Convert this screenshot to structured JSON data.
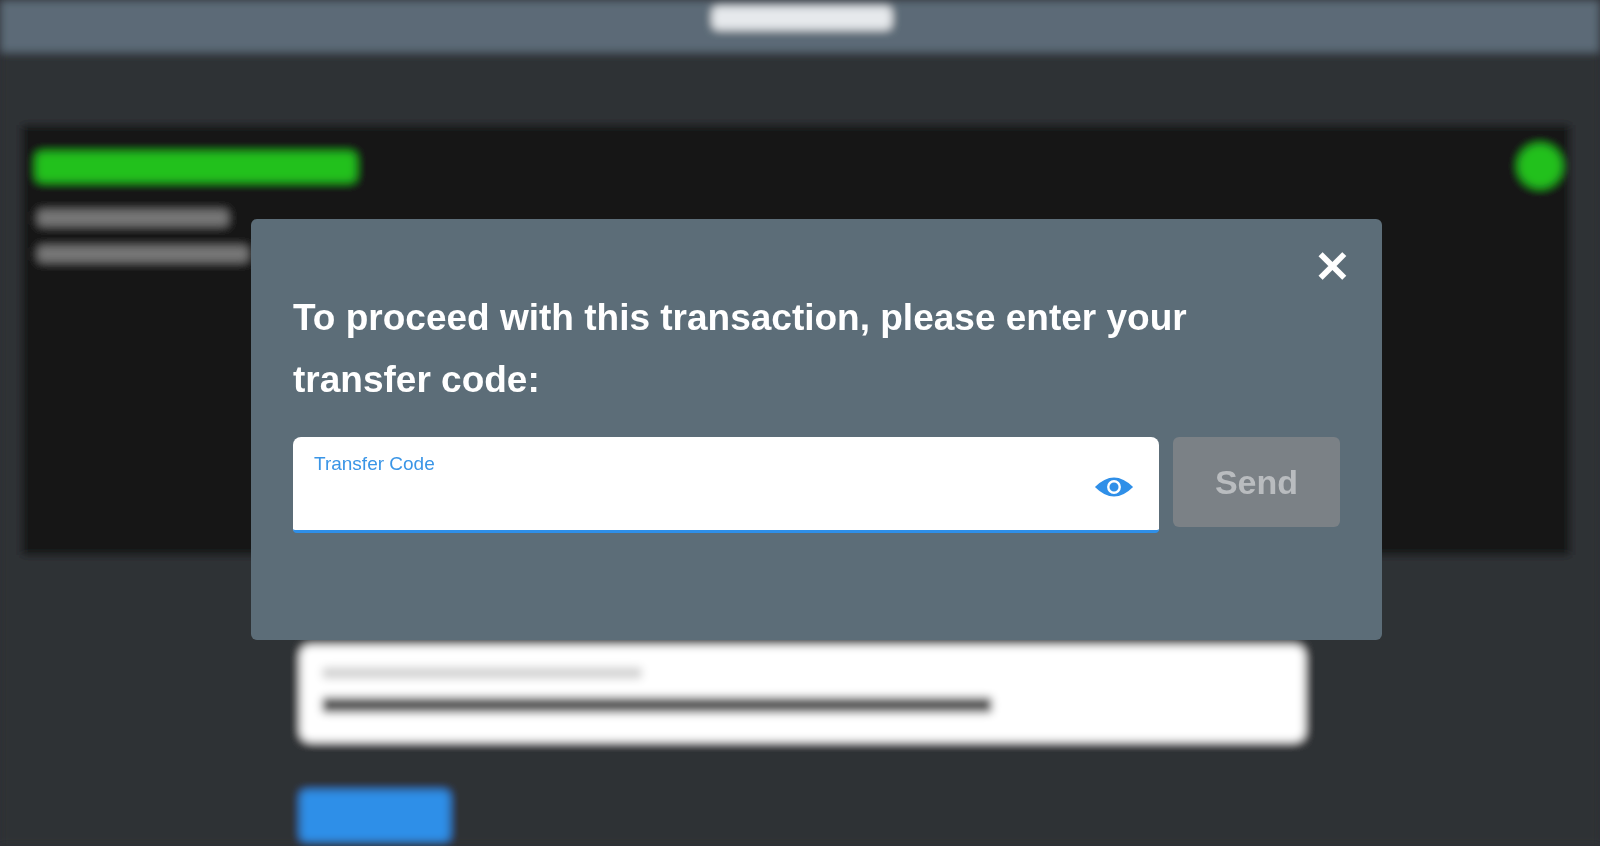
{
  "dialog": {
    "message": "To proceed with this transaction, please enter your transfer code:",
    "close": "✕",
    "field": {
      "label": "Transfer Code",
      "focused": true,
      "masked": true
    },
    "send_button": {
      "label": "Send",
      "disabled": true
    }
  }
}
